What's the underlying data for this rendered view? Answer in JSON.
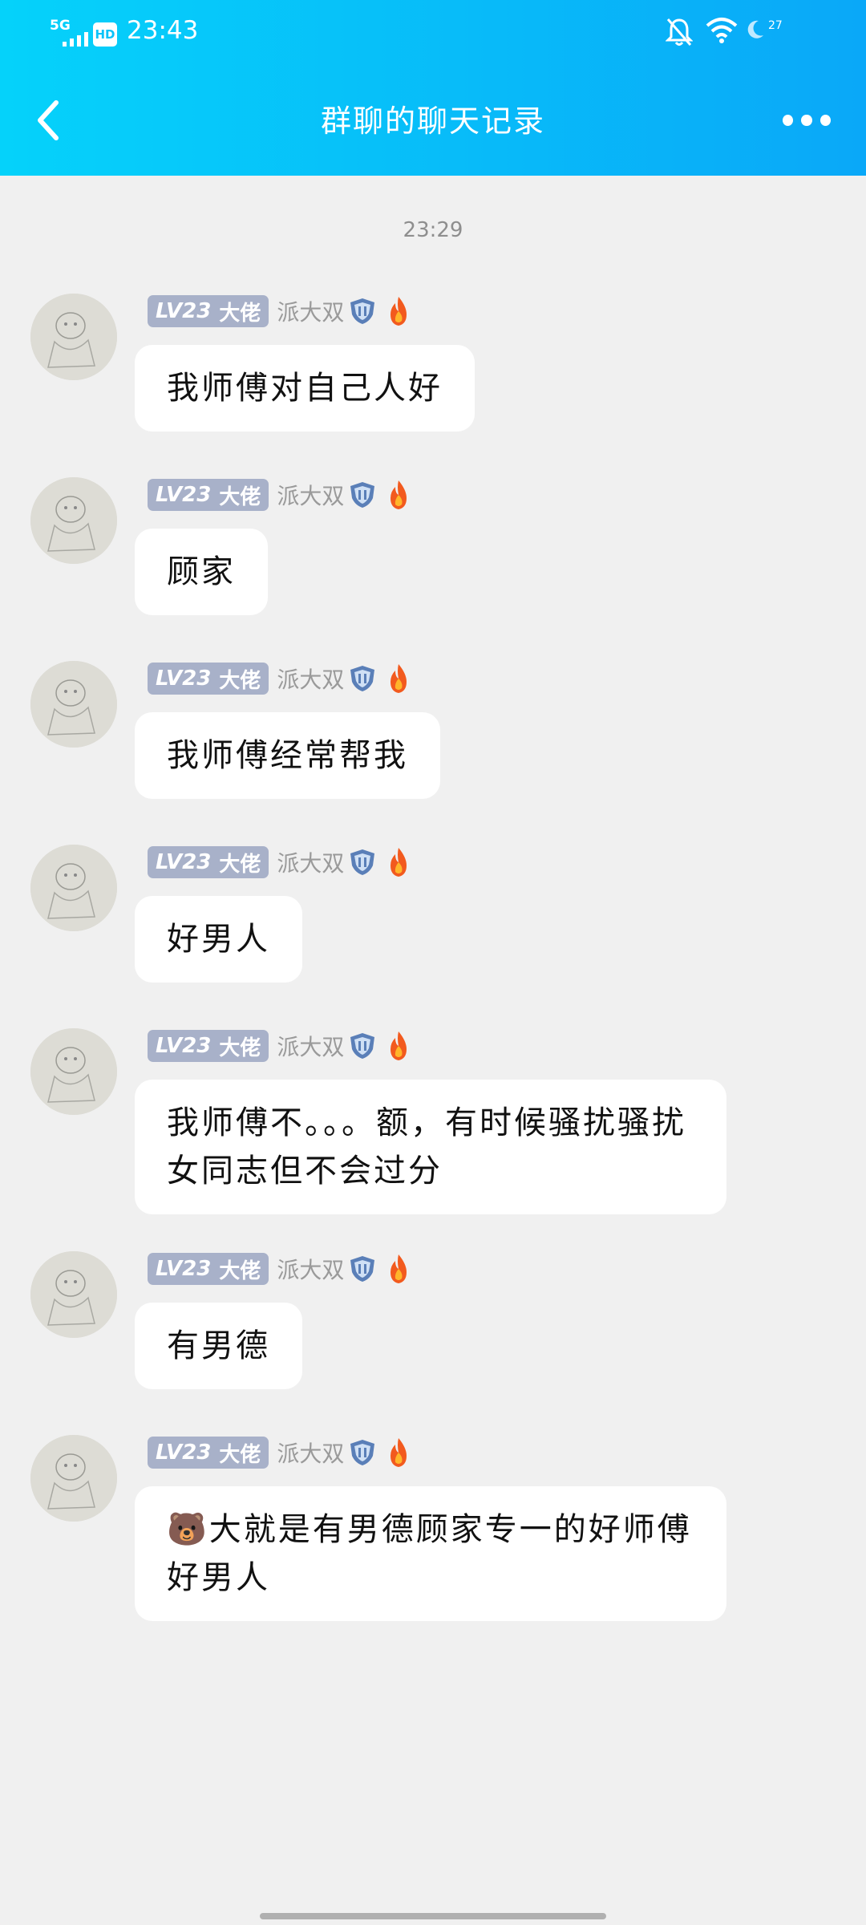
{
  "status_bar": {
    "network": "5G",
    "hd": "HD",
    "time": "23:43",
    "battery": "27"
  },
  "header": {
    "title": "群聊的聊天记录"
  },
  "timestamp": "23:29",
  "sender": {
    "level": "LV23",
    "rank": "大佬",
    "nickname": "派大双"
  },
  "messages": [
    {
      "text": "我师傅对自己人好"
    },
    {
      "text": "顾家"
    },
    {
      "text": "我师傅经常帮我"
    },
    {
      "text": "好男人"
    },
    {
      "text": "我师傅不。。。额，有时候骚扰骚扰女同志但不会过分"
    },
    {
      "text": "有男德"
    },
    {
      "text": "🐻大就是有男德顾家专一的好师傅好男人"
    }
  ],
  "colors": {
    "header_start": "#05d2fa",
    "header_end": "#0aa8f8",
    "background": "#f0f0f0",
    "badge": "#a8b1c9",
    "nickname": "#9a9a9a"
  }
}
